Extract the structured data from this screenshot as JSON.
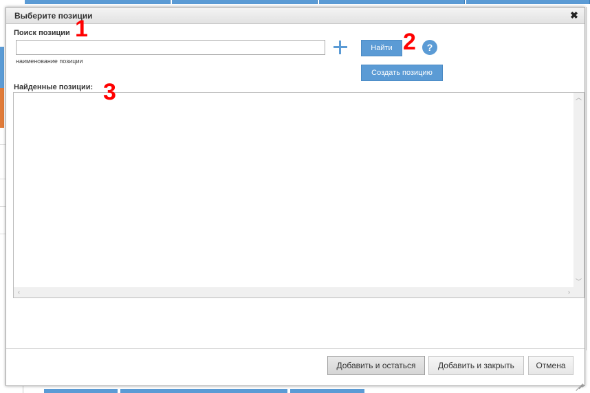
{
  "dialog": {
    "title": "Выберите позиции",
    "close_glyph": "✖"
  },
  "search": {
    "label": "Поиск позиции",
    "value": "",
    "placeholder": "",
    "hint": "наименование позиции"
  },
  "actions": {
    "find_label": "Найти",
    "create_label": "Создать позицию",
    "help_glyph": "?",
    "add_icon": "plus-icon"
  },
  "results": {
    "label": "Найденные позиции:",
    "items": []
  },
  "annotations": [
    "1",
    "2",
    "3"
  ],
  "footer": {
    "add_stay_label": "Добавить и остаться",
    "add_close_label": "Добавить и закрыть",
    "cancel_label": "Отмена"
  },
  "colors": {
    "accent": "#5b9bd5",
    "annotation": "#ff0000",
    "side_orange": "#e07b39"
  }
}
